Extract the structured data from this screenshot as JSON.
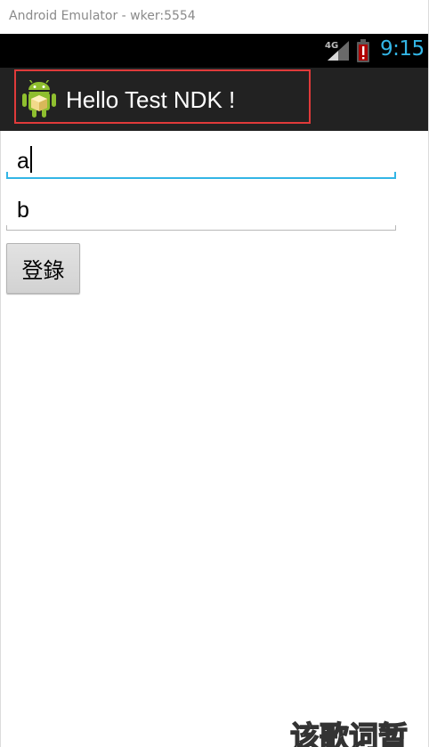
{
  "window": {
    "title": "Android Emulator - wker:5554"
  },
  "status_bar": {
    "network_label": "4G",
    "time": "9:15",
    "colors": {
      "time": "#33b5e5",
      "battery_alert": "#cc0000"
    }
  },
  "action_bar": {
    "title": "Hello Test NDK !",
    "icon": "android-robot-icon",
    "highlight_color": "#e03a3a"
  },
  "form": {
    "field_a_value": "a",
    "field_b_value": "b",
    "login_button_label": "登錄",
    "accent_color": "#33b5e5"
  },
  "watermark": {
    "text": "该歌词暂"
  }
}
